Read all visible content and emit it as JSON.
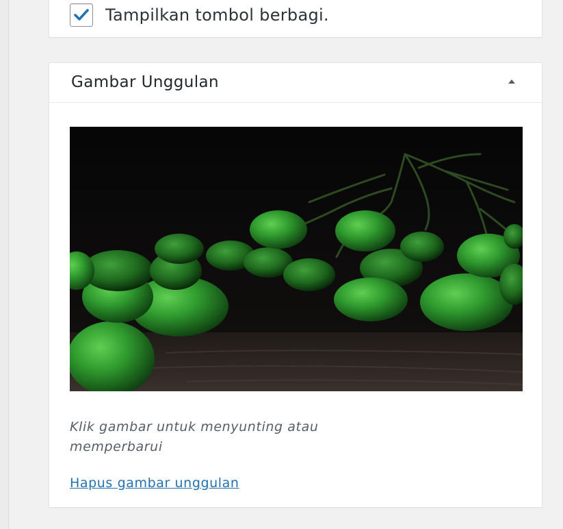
{
  "sharing_option": {
    "checked": true,
    "label": "Tampilkan tombol berbagi."
  },
  "featured_image_panel": {
    "title": "Gambar Unggulan",
    "toggle_icon": "triangle-up-icon",
    "image_description": "green round berries on stems against dark background",
    "help_line_1": "Klik gambar untuk menyunting atau",
    "help_line_2": "memperbarui",
    "remove_link": "Hapus gambar unggulan"
  },
  "colors": {
    "link": "#2271b1",
    "checkmark": "#2271b1",
    "panel_border": "#e2e4e7",
    "background": "#f1f1f1"
  }
}
